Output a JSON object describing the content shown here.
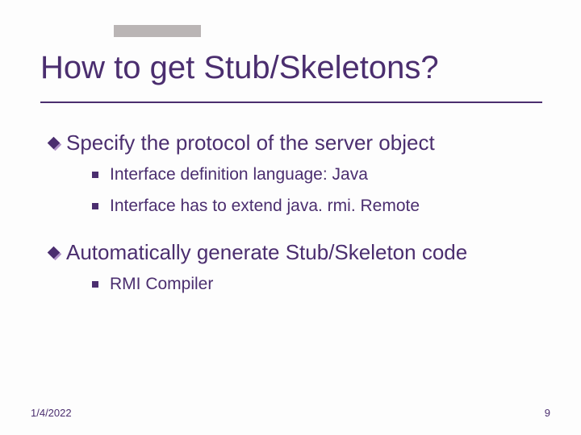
{
  "title": "How to get Stub/Skeletons?",
  "bullets": [
    {
      "text": "Specify the protocol of the server object",
      "sub": [
        "Interface definition language: Java",
        "Interface has to extend java. rmi. Remote"
      ]
    },
    {
      "text": "Automatically generate Stub/Skeleton code",
      "sub": [
        "RMI Compiler"
      ]
    }
  ],
  "footer": {
    "date": "1/4/2022",
    "page": "9"
  }
}
